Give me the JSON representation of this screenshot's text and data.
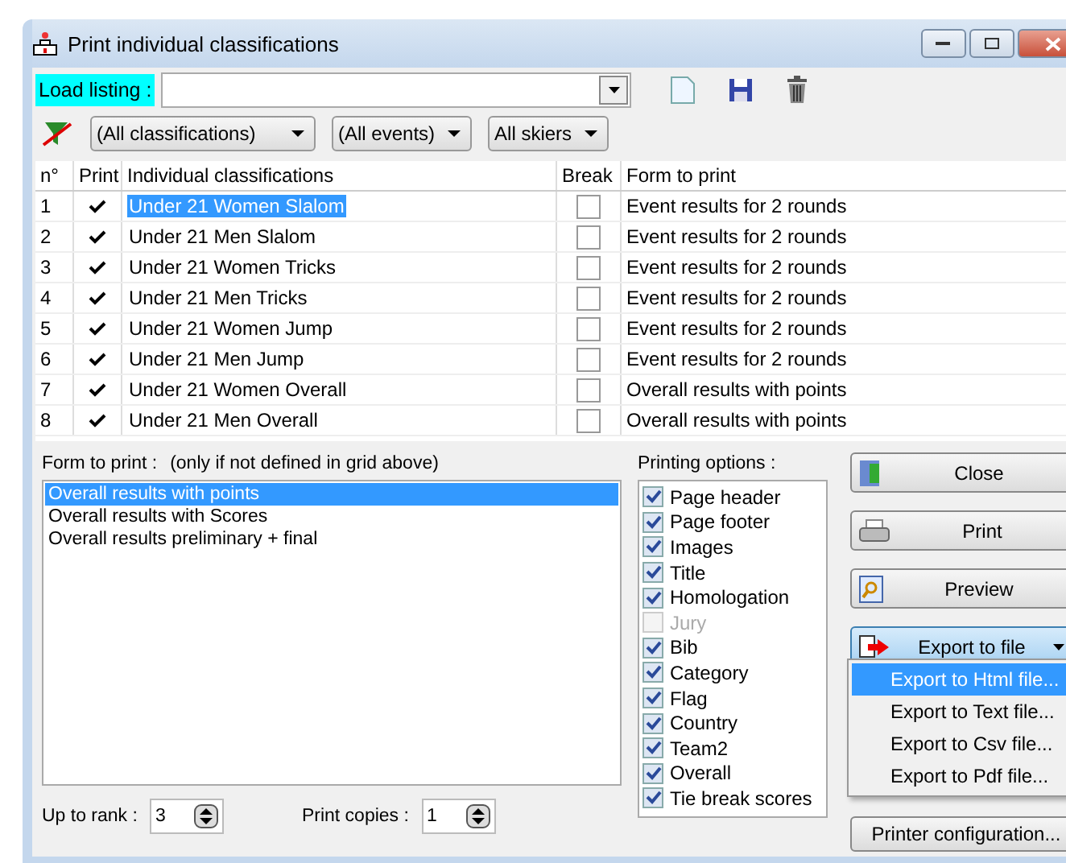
{
  "window": {
    "title": "Print individual classifications"
  },
  "load_listing": {
    "label": "Load listing :"
  },
  "filters": [
    {
      "value": "(All classifications)"
    },
    {
      "value": "(All events)"
    },
    {
      "value": "All skiers"
    }
  ],
  "grid": {
    "columns": [
      "n°",
      "Print",
      "Individual classifications",
      "Break",
      "Form to print"
    ],
    "rows": [
      {
        "n": "1",
        "print": true,
        "classification": "Under 21 Women Slalom",
        "break": false,
        "form": "Event results for 2 rounds",
        "selected": true
      },
      {
        "n": "2",
        "print": true,
        "classification": "Under 21 Men Slalom",
        "break": false,
        "form": "Event results for 2 rounds",
        "selected": false
      },
      {
        "n": "3",
        "print": true,
        "classification": "Under 21 Women Tricks",
        "break": false,
        "form": "Event results for 2 rounds",
        "selected": false
      },
      {
        "n": "4",
        "print": true,
        "classification": "Under 21 Men Tricks",
        "break": false,
        "form": "Event results for 2 rounds",
        "selected": false
      },
      {
        "n": "5",
        "print": true,
        "classification": "Under 21 Women Jump",
        "break": false,
        "form": "Event results for 2 rounds",
        "selected": false
      },
      {
        "n": "6",
        "print": true,
        "classification": "Under 21 Men Jump",
        "break": false,
        "form": "Event results for 2 rounds",
        "selected": false
      },
      {
        "n": "7",
        "print": true,
        "classification": "Under 21 Women Overall",
        "break": false,
        "form": "Overall results with points",
        "selected": false
      },
      {
        "n": "8",
        "print": true,
        "classification": "Under 21 Men Overall",
        "break": false,
        "form": "Overall results with points",
        "selected": false
      }
    ]
  },
  "form_to_print": {
    "label": "Form to print :",
    "note": "(only if not defined in grid above)",
    "items": [
      {
        "label": "Overall results with points",
        "selected": true
      },
      {
        "label": "Overall results with Scores",
        "selected": false
      },
      {
        "label": "Overall results preliminary + final",
        "selected": false
      }
    ]
  },
  "up_to_rank": {
    "label": "Up to rank :",
    "value": "3"
  },
  "print_copies": {
    "label": "Print copies :",
    "value": "1"
  },
  "printing_options": {
    "label": "Printing options :",
    "items": [
      {
        "label": "Page header",
        "checked": true,
        "disabled": false
      },
      {
        "label": "Page footer",
        "checked": true,
        "disabled": false
      },
      {
        "label": "Images",
        "checked": true,
        "disabled": false
      },
      {
        "label": "Title",
        "checked": true,
        "disabled": false
      },
      {
        "label": "Homologation",
        "checked": true,
        "disabled": false
      },
      {
        "label": "Jury",
        "checked": false,
        "disabled": true
      },
      {
        "label": "Bib",
        "checked": true,
        "disabled": false
      },
      {
        "label": "Category",
        "checked": true,
        "disabled": false
      },
      {
        "label": "Flag",
        "checked": true,
        "disabled": false
      },
      {
        "label": "Country",
        "checked": true,
        "disabled": false
      },
      {
        "label": "Team2",
        "checked": true,
        "disabled": false
      },
      {
        "label": "Overall",
        "checked": true,
        "disabled": false
      },
      {
        "label": "Tie break scores",
        "checked": true,
        "disabled": false
      }
    ]
  },
  "buttons": [
    {
      "kind": "close",
      "label": "Close"
    },
    {
      "kind": "print",
      "label": "Print"
    },
    {
      "kind": "preview",
      "label": "Preview"
    },
    {
      "kind": "export",
      "label": "Export to file",
      "expanded": true
    }
  ],
  "export_menu": [
    {
      "label": "Export to Html file...",
      "selected": true
    },
    {
      "label": "Export to Text file...",
      "selected": false
    },
    {
      "label": "Export to Csv file...",
      "selected": false
    },
    {
      "label": "Export to Pdf file...",
      "selected": false
    }
  ],
  "printer_configuration": {
    "label": "Printer configuration..."
  }
}
